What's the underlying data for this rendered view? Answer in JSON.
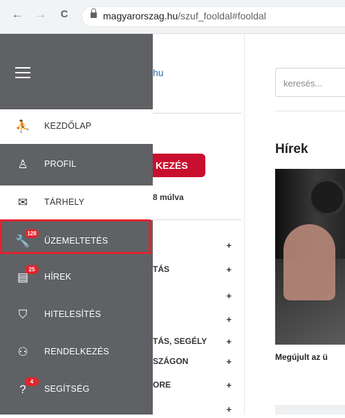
{
  "browser": {
    "back_glyph": "←",
    "forward_glyph": "→",
    "reload_glyph": "C",
    "url_domain": "magyarorszag.hu",
    "url_path": "/szuf_fooldal#fooldal"
  },
  "page": {
    "partial_link": "hu",
    "partial_login_button": "KEZÉS",
    "partial_small_text": "8 múlva",
    "partial_menu": [
      {
        "label": "",
        "plus": "+"
      },
      {
        "label": "TÁS",
        "plus": "+"
      },
      {
        "label": "",
        "plus": "+"
      },
      {
        "label": "",
        "plus": "+"
      },
      {
        "label": "TÁS, SEGÉLY",
        "plus": "+"
      },
      {
        "label": "SZÁGON",
        "plus": "+"
      },
      {
        "label": "ORE",
        "plus": "+"
      },
      {
        "label": "",
        "plus": "+"
      }
    ],
    "search_placeholder": "keresés...",
    "news_heading": "Hírek",
    "news_caption": "Megújult az ü"
  },
  "sidebar": {
    "items": [
      {
        "label": "KEZDŐLAP",
        "icon": "home-figure-icon",
        "glyph": "⛹",
        "badge": ""
      },
      {
        "label": "PROFIL",
        "icon": "user-icon",
        "glyph": "♙",
        "badge": ""
      },
      {
        "label": "TÁRHELY",
        "icon": "envelope-icon",
        "glyph": "✉",
        "badge": ""
      },
      {
        "label": "ÜZEMELTETÉS",
        "icon": "wrench-icon",
        "glyph": "🔧",
        "badge": "128"
      },
      {
        "label": "HÍREK",
        "icon": "newspaper-icon",
        "glyph": "▤",
        "badge": "25"
      },
      {
        "label": "HITELESÍTÉS",
        "icon": "shield-icon",
        "glyph": "⛉",
        "badge": ""
      },
      {
        "label": "RENDELKEZÉS",
        "icon": "user-add-icon",
        "glyph": "⚇",
        "badge": ""
      },
      {
        "label": "SEGÍTSÉG",
        "icon": "help-icon",
        "glyph": "?",
        "badge": "4"
      }
    ]
  },
  "colors": {
    "sidebar_bg": "#5f6164",
    "highlight_border": "#e0242f",
    "brand_red": "#c8102e",
    "badge_red": "#e2252e"
  }
}
